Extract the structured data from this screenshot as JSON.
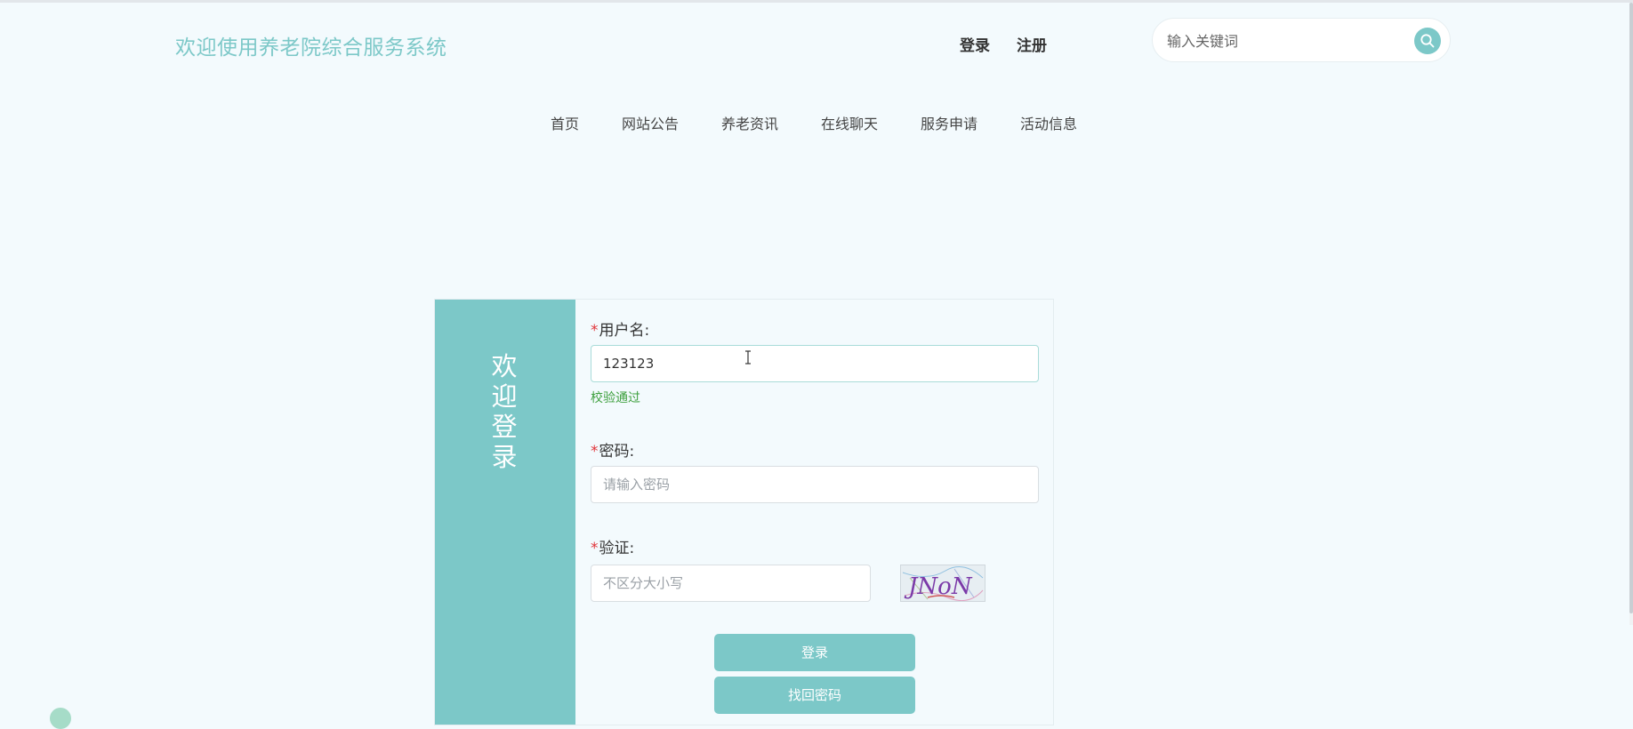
{
  "header": {
    "site_title": "欢迎使用养老院综合服务系统",
    "login_link": "登录",
    "register_link": "注册",
    "search": {
      "placeholder": "输入关键词",
      "value": "",
      "icon": "search-icon"
    }
  },
  "nav": {
    "items": [
      {
        "label": "首页"
      },
      {
        "label": "网站公告"
      },
      {
        "label": "养老资讯"
      },
      {
        "label": "在线聊天"
      },
      {
        "label": "服务申请"
      },
      {
        "label": "活动信息"
      }
    ]
  },
  "login_form": {
    "side_title": "欢迎登录",
    "required_mark": "*",
    "username": {
      "label": "用户名:",
      "value": "123123",
      "placeholder": "",
      "validation": "校验通过"
    },
    "password": {
      "label": "密码:",
      "value": "",
      "placeholder": "请输入密码"
    },
    "captcha": {
      "label": "验证:",
      "value": "",
      "placeholder": "不区分大小写",
      "code": "JNoN"
    },
    "login_button": "登录",
    "recover_button": "找回密码"
  },
  "colors": {
    "accent": "#7cc8c8",
    "background": "#f3fafd",
    "required": "#e0353a",
    "valid": "#3ea03e"
  }
}
